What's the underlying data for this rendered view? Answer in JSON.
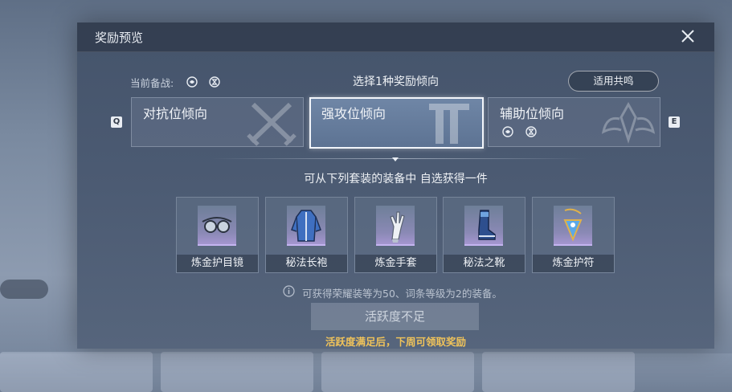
{
  "dialog": {
    "title": "奖励预览",
    "close_icon": "close-icon"
  },
  "header": {
    "current_label": "当前备战:",
    "current_icons": [
      "swirl-emblem-icon",
      "hourglass-emblem-icon"
    ],
    "select_title": "选择1种奖励倾向",
    "apply_button": "适用共鸣"
  },
  "keys": {
    "left": "Q",
    "right": "E"
  },
  "tabs": [
    {
      "label": "对抗位倾向",
      "emblem": "crossed-swords-icon",
      "selected": false
    },
    {
      "label": "强攻位倾向",
      "emblem": "pillar-emblem-icon",
      "selected": true
    },
    {
      "label": "辅助位倾向",
      "emblem": "wing-crest-icon",
      "selected": false,
      "icons": [
        "swirl-emblem-icon",
        "hourglass-emblem-icon"
      ]
    }
  ],
  "subtitle": "可从下列套装的装备中 自选获得一件",
  "items": [
    {
      "name": "炼金护目镜",
      "icon": "goggles-icon"
    },
    {
      "name": "秘法长袍",
      "icon": "robe-icon"
    },
    {
      "name": "炼金手套",
      "icon": "glove-icon"
    },
    {
      "name": "秘法之靴",
      "icon": "boot-icon"
    },
    {
      "name": "炼金护符",
      "icon": "amulet-icon"
    }
  ],
  "info_text": "可获得荣耀装等为50、词条等级为2的装备。",
  "action_button": "活跃度不足",
  "warning": "活跃度满足后，下周可领取奖励",
  "colors": {
    "dialog_bg": "#4b5a72",
    "warning": "#f0c35a",
    "selected_tab": "#6f86a6"
  }
}
